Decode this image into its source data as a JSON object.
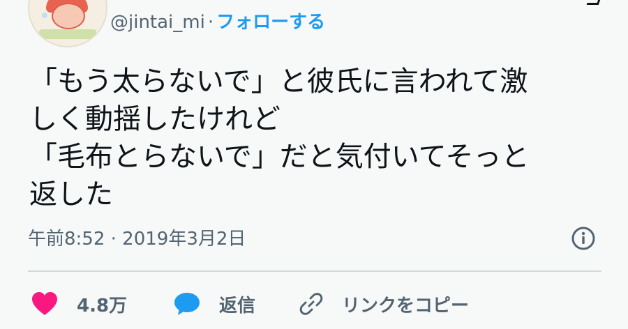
{
  "header": {
    "handle": "@jintai_mi",
    "separator": "·",
    "follow_label": "フォローする"
  },
  "tweet": {
    "lines": [
      "「もう太らないで」と彼氏に言われて激",
      "しく動揺したけれど",
      "「毛布とらないで」だと気付いてそっと",
      "返した"
    ]
  },
  "meta": {
    "timestamp": "午前8:52 · 2019年3月2日"
  },
  "actions": {
    "like_count": "4.8万",
    "reply_label": "返信",
    "copy_link_label": "リンクをコピー"
  },
  "icons": {
    "heart": "heart-icon",
    "reply": "speech-bubble-icon",
    "link": "link-icon",
    "info": "info-icon"
  },
  "colors": {
    "background": "#f7f9f9",
    "text": "#0f1419",
    "secondary": "#536471",
    "accent": "#1d9bf0",
    "like": "#f91880"
  }
}
